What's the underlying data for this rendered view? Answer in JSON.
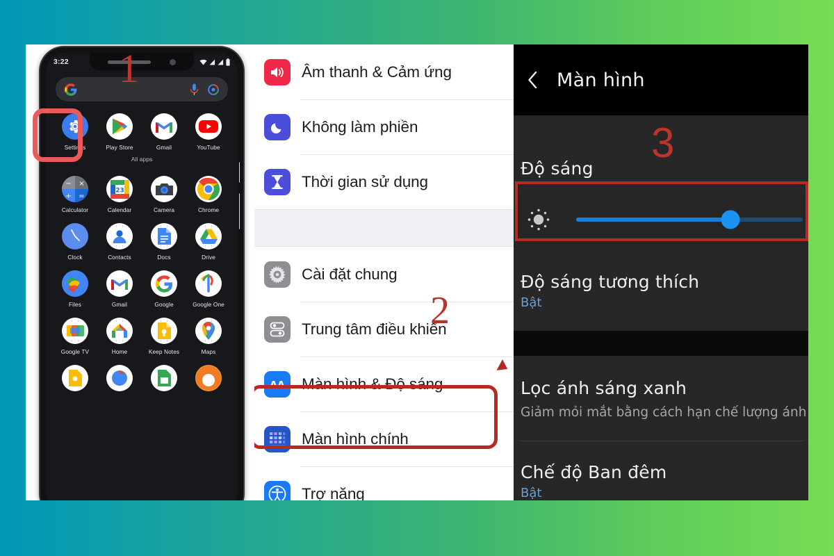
{
  "background": {
    "gradient_from": "#0098b8",
    "gradient_to": "#76dd55"
  },
  "phone": {
    "status_bar": {
      "time": "3:22",
      "wifi_icon": "wifi-icon",
      "signal_icon": "signal-bars-icon",
      "battery_icon": "battery-icon"
    },
    "search_bar": {
      "logo": "google-g-icon",
      "mic": "microphone-icon",
      "lens": "google-lens-icon"
    },
    "annotation_number": "1",
    "all_apps_label": "All apps",
    "favorites": [
      {
        "label": "Settings",
        "icon": "settings-gear-icon",
        "highlighted": true
      },
      {
        "label": "Play Store",
        "icon": "play-store-icon",
        "highlighted": false
      },
      {
        "label": "Gmail",
        "icon": "gmail-icon",
        "highlighted": false
      },
      {
        "label": "YouTube",
        "icon": "youtube-icon",
        "highlighted": false
      }
    ],
    "apps": [
      {
        "label": "Calculator",
        "icon": "calculator-icon"
      },
      {
        "label": "Calendar",
        "icon": "calendar-icon"
      },
      {
        "label": "Camera",
        "icon": "camera-icon"
      },
      {
        "label": "Chrome",
        "icon": "chrome-icon"
      },
      {
        "label": "Clock",
        "icon": "clock-icon"
      },
      {
        "label": "Contacts",
        "icon": "contacts-icon"
      },
      {
        "label": "Docs",
        "icon": "docs-icon"
      },
      {
        "label": "Drive",
        "icon": "drive-icon"
      },
      {
        "label": "Files",
        "icon": "files-icon"
      },
      {
        "label": "Gmail",
        "icon": "gmail-icon"
      },
      {
        "label": "Google",
        "icon": "google-g-icon"
      },
      {
        "label": "Google One",
        "icon": "google-one-icon"
      },
      {
        "label": "Google TV",
        "icon": "google-tv-icon"
      },
      {
        "label": "Home",
        "icon": "google-home-icon"
      },
      {
        "label": "Keep Notes",
        "icon": "keep-notes-icon"
      },
      {
        "label": "Maps",
        "icon": "google-maps-icon"
      }
    ]
  },
  "settings_list": {
    "annotation_number": "2",
    "highlighted_row_label": "Màn hình & Độ sáng",
    "group_one": [
      {
        "label": "Âm thanh & Cảm ứng",
        "icon": "speaker-icon",
        "icon_color": "#f0284a"
      },
      {
        "label": "Không làm phiền",
        "icon": "moon-icon",
        "icon_color": "#4b4ddb"
      },
      {
        "label": "Thời gian sử dụng",
        "icon": "hourglass-icon",
        "icon_color": "#4b4ddb"
      }
    ],
    "group_two": [
      {
        "label": "Cài đặt chung",
        "icon": "gear-icon",
        "icon_color": "#8e8e93"
      },
      {
        "label": "Trung tâm điều khiển",
        "icon": "control-center-icon",
        "icon_color": "#8e8e93"
      },
      {
        "label": "Màn hình & Độ sáng",
        "icon": "text-size-aa-icon",
        "icon_color": "#1a7af5"
      },
      {
        "label": "Màn hình chính",
        "icon": "home-screen-grid-icon",
        "icon_color": "#2655c8"
      },
      {
        "label": "Trợ năng",
        "icon": "accessibility-icon",
        "icon_color": "#1a7af5"
      }
    ]
  },
  "display_screen": {
    "annotation_number": "3",
    "back_icon": "back-chevron-icon",
    "title": "Màn hình",
    "brightness": {
      "label": "Độ sáng",
      "slider_icon": "brightness-sun-icon",
      "value_percent": 68
    },
    "items": [
      {
        "title": "Độ sáng tương thích",
        "subtitle": "Bật",
        "description": ""
      },
      {
        "title": "Lọc ánh sáng xanh",
        "subtitle": "",
        "description": "Giảm mỏi mắt bằng cách hạn chế lượng ánh sáng phát ra từ màn hình."
      },
      {
        "title": "Chế độ Ban đêm",
        "subtitle": "Bật",
        "description": ""
      }
    ]
  },
  "colors": {
    "accent_blue": "#1a93f5",
    "annotation_red": "#b52a22",
    "highlight_salmon": "#ea5a5a"
  }
}
